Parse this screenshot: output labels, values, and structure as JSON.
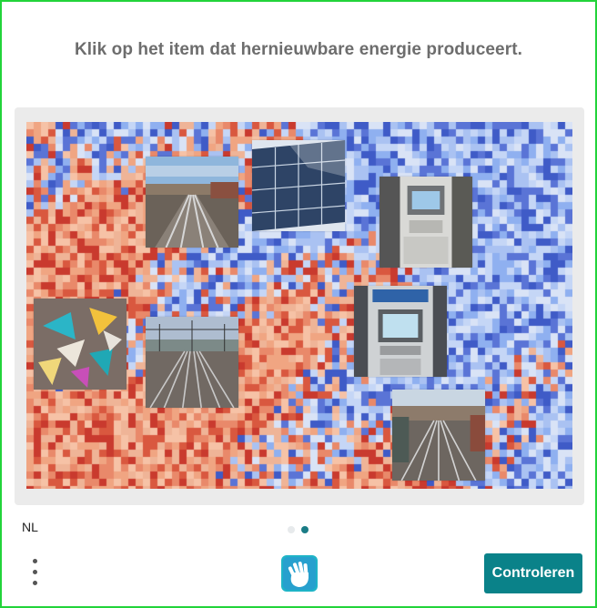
{
  "challenge": {
    "prompt": "Klik op het item dat hernieuwbare energie produceert."
  },
  "tiles": [
    {
      "name": "railway-tracks-tile",
      "icon": "railway-tracks-image"
    },
    {
      "name": "solar-panel-tile",
      "icon": "solar-panel-image"
    },
    {
      "name": "atm-machine-tile",
      "icon": "atm-machine-image"
    },
    {
      "name": "paper-boats-tile",
      "icon": "paper-origami-image"
    },
    {
      "name": "railway-yard-tile",
      "icon": "railway-yard-image"
    },
    {
      "name": "atm-kiosk-tile",
      "icon": "atm-kiosk-image"
    },
    {
      "name": "railway-station-tile",
      "icon": "railway-station-image"
    }
  ],
  "footer": {
    "language": "NL",
    "pagination": {
      "total": 2,
      "current": 2
    },
    "menu_icon": "vertical-dots-icon",
    "logo_icon": "hand-logo-icon",
    "submit_label": "Controleren"
  },
  "colors": {
    "accent": "#0a8289",
    "prompt_text": "#6d6d6d",
    "frame_border": "#22d43a"
  }
}
